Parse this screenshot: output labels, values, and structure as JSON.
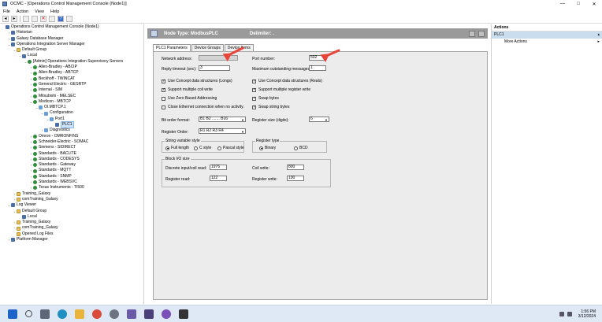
{
  "window": {
    "title": "OCMC - [Operations Control Management Console (Node1)]",
    "controls": [
      "—",
      "□",
      "✕"
    ]
  },
  "menu": [
    "File",
    "Action",
    "View",
    "Help"
  ],
  "tree": [
    {
      "label": "Operations Control Management Console (Node1)",
      "indent": 0,
      "icon": "comp",
      "toggle": ""
    },
    {
      "label": "Historian",
      "indent": 1,
      "icon": "comp",
      "toggle": ">"
    },
    {
      "label": "Galaxy Database Manager",
      "indent": 1,
      "icon": "comp",
      "toggle": ">"
    },
    {
      "label": "Operations Integration Server Manager",
      "indent": 1,
      "icon": "comp",
      "toggle": "v"
    },
    {
      "label": "Default Group",
      "indent": 2,
      "icon": "folder",
      "toggle": "v"
    },
    {
      "label": "Local",
      "indent": 3,
      "icon": "comp",
      "toggle": "v"
    },
    {
      "label": "[Admin] Operations Integration Supervisory Servers",
      "indent": 4,
      "icon": "green",
      "toggle": "v"
    },
    {
      "label": "Allen-Bradley - ABCIP",
      "indent": 5,
      "icon": "green",
      "toggle": ">"
    },
    {
      "label": "Allen-Bradley - ABTCP",
      "indent": 5,
      "icon": "green",
      "toggle": ">"
    },
    {
      "label": "Beckhoff - TWINCAT",
      "indent": 5,
      "icon": "green",
      "toggle": ">"
    },
    {
      "label": "General Electric - GESRTP",
      "indent": 5,
      "icon": "green",
      "toggle": ">"
    },
    {
      "label": "Internal - SIM",
      "indent": 5,
      "icon": "green",
      "toggle": ">"
    },
    {
      "label": "Mitsubishi - MELSEC",
      "indent": 5,
      "icon": "green",
      "toggle": ">"
    },
    {
      "label": "Modicon - MBTCP",
      "indent": 5,
      "icon": "green",
      "toggle": "v"
    },
    {
      "label": "OI.MBTCP.1",
      "indent": 6,
      "icon": "blue",
      "toggle": "v"
    },
    {
      "label": "Configuration",
      "indent": 7,
      "icon": "blue",
      "toggle": "v"
    },
    {
      "label": "Port1",
      "indent": 8,
      "icon": "blue",
      "toggle": "v"
    },
    {
      "label": "PLC1",
      "indent": 9,
      "icon": "plc",
      "toggle": "",
      "selected": true
    },
    {
      "label": "Diagnostics",
      "indent": 7,
      "icon": "blue",
      "toggle": ">"
    },
    {
      "label": "Omron - OMRONFINS",
      "indent": 5,
      "icon": "green",
      "toggle": ">"
    },
    {
      "label": "Schneider-Electric - SOMAC",
      "indent": 5,
      "icon": "green",
      "toggle": ">"
    },
    {
      "label": "Siemens - SIDIRECT",
      "indent": 5,
      "icon": "green",
      "toggle": ">"
    },
    {
      "label": "Standards - BACLITE",
      "indent": 5,
      "icon": "green",
      "toggle": ">"
    },
    {
      "label": "Standards - CODESYS",
      "indent": 5,
      "icon": "green",
      "toggle": ">"
    },
    {
      "label": "Standards - Gateway",
      "indent": 5,
      "icon": "green",
      "toggle": ">"
    },
    {
      "label": "Standards - MQTT",
      "indent": 5,
      "icon": "green",
      "toggle": ">"
    },
    {
      "label": "Standards - SNMP",
      "indent": 5,
      "icon": "green",
      "toggle": ">"
    },
    {
      "label": "Standards - WEBSVC",
      "indent": 5,
      "icon": "green",
      "toggle": ">"
    },
    {
      "label": "Texas Instruments - TI500",
      "indent": 5,
      "icon": "green",
      "toggle": ">"
    },
    {
      "label": "Training_Galaxy",
      "indent": 2,
      "icon": "folder",
      "toggle": ">"
    },
    {
      "label": "comTraining_Galaxy",
      "indent": 2,
      "icon": "folder",
      "toggle": ">"
    },
    {
      "label": "Log Viewer",
      "indent": 1,
      "icon": "comp",
      "toggle": "v"
    },
    {
      "label": "Default Group",
      "indent": 2,
      "icon": "folder",
      "toggle": "v"
    },
    {
      "label": "Local",
      "indent": 3,
      "icon": "comp",
      "toggle": ""
    },
    {
      "label": "Training_Galaxy",
      "indent": 2,
      "icon": "folder",
      "toggle": ">"
    },
    {
      "label": "comTraining_Galaxy",
      "indent": 2,
      "icon": "folder",
      "toggle": ">"
    },
    {
      "label": "Opened Log Files",
      "indent": 2,
      "icon": "folder",
      "toggle": ""
    },
    {
      "label": "Platform Manager",
      "indent": 1,
      "icon": "comp",
      "toggle": ">"
    }
  ],
  "node": {
    "type_label": "Node Type:  ModbusPLC",
    "delimiter_label": "Delimiter:  ."
  },
  "tabs": [
    "PLC1 Parameters",
    "Device Groups",
    "Device Items"
  ],
  "form": {
    "network_address_label": "Network address:",
    "network_address_value": "",
    "port_number_label": "Port number:",
    "port_number_value": "502",
    "reply_timeout_label": "Reply timeout (sec):",
    "reply_timeout_value": "3",
    "max_outstanding_label": "Maximum outstanding messages:",
    "max_outstanding_value": "1",
    "checks_left": [
      {
        "label": "Use Concept data structures (Longs)",
        "checked": true
      },
      {
        "label": "Support multiple coil write",
        "checked": true
      },
      {
        "label": "Use Zero Based Addressing",
        "checked": false
      },
      {
        "label": "Close Ethernet connection when no activity.",
        "checked": false
      }
    ],
    "checks_right": [
      {
        "label": "Use Concept data structures (Reals)",
        "checked": true
      },
      {
        "label": "Support multiple register write",
        "checked": true
      },
      {
        "label": "Swap bytes",
        "checked": true
      },
      {
        "label": "Swap string bytes",
        "checked": true
      }
    ],
    "bit_order_label": "Bit order format:",
    "bit_order_value": "B1  B2  .......  B16",
    "register_size_label": "Register size (digits):",
    "register_size_value": "6",
    "register_order_label": "Register Order:",
    "register_order_value": "R1 R2 R3 R4",
    "string_style_title": "String variable style",
    "string_options": [
      {
        "label": "Full length",
        "selected": true
      },
      {
        "label": "C style",
        "selected": false
      },
      {
        "label": "Pascal style",
        "selected": false
      }
    ],
    "register_type_title": "Register type",
    "register_types": [
      {
        "label": "Binary",
        "selected": true
      },
      {
        "label": "BCD",
        "selected": false
      }
    ],
    "block_title": "Block I/O size",
    "discrete_label": "Discrete input/coil read:",
    "discrete_value": "1976",
    "coil_write_label": "Coil write:",
    "coil_write_value": "800",
    "register_read_label": "Register read:",
    "register_read_value": "122",
    "register_write_label": "Register write:",
    "register_write_value": "100"
  },
  "actions": {
    "header": "Actions",
    "sub": "PLC1",
    "items": [
      "More Actions"
    ]
  },
  "annotation_color": "#e8443a",
  "taskbar": {
    "time": "1:56 PM",
    "date": "3/12/2024"
  }
}
